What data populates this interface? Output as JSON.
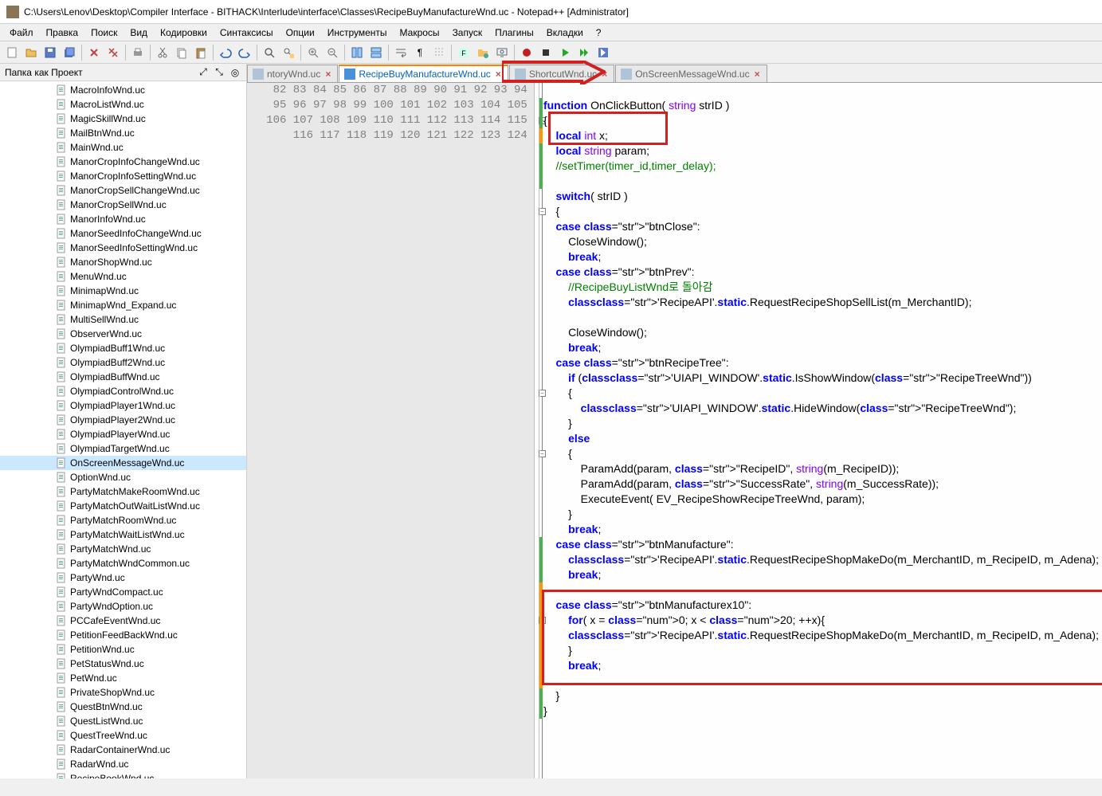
{
  "window": {
    "title": "C:\\Users\\Lenov\\Desktop\\Compiler  Interface - BITHACK\\Interlude\\interface\\Classes\\RecipeBuyManufactureWnd.uc - Notepad++ [Administrator]"
  },
  "menu": {
    "items": [
      "Файл",
      "Правка",
      "Поиск",
      "Вид",
      "Кодировки",
      "Синтаксисы",
      "Опции",
      "Инструменты",
      "Макросы",
      "Запуск",
      "Плагины",
      "Вкладки",
      "?"
    ]
  },
  "sidebar": {
    "title": "Папка как Проект",
    "files": [
      "MacroInfoWnd.uc",
      "MacroListWnd.uc",
      "MagicSkillWnd.uc",
      "MailBtnWnd.uc",
      "MainWnd.uc",
      "ManorCropInfoChangeWnd.uc",
      "ManorCropInfoSettingWnd.uc",
      "ManorCropSellChangeWnd.uc",
      "ManorCropSellWnd.uc",
      "ManorInfoWnd.uc",
      "ManorSeedInfoChangeWnd.uc",
      "ManorSeedInfoSettingWnd.uc",
      "ManorShopWnd.uc",
      "MenuWnd.uc",
      "MinimapWnd.uc",
      "MinimapWnd_Expand.uc",
      "MultiSellWnd.uc",
      "ObserverWnd.uc",
      "OlympiadBuff1Wnd.uc",
      "OlympiadBuff2Wnd.uc",
      "OlympiadBuffWnd.uc",
      "OlympiadControlWnd.uc",
      "OlympiadPlayer1Wnd.uc",
      "OlympiadPlayer2Wnd.uc",
      "OlympiadPlayerWnd.uc",
      "OlympiadTargetWnd.uc",
      "OnScreenMessageWnd.uc",
      "OptionWnd.uc",
      "PartyMatchMakeRoomWnd.uc",
      "PartyMatchOutWaitListWnd.uc",
      "PartyMatchRoomWnd.uc",
      "PartyMatchWaitListWnd.uc",
      "PartyMatchWnd.uc",
      "PartyMatchWndCommon.uc",
      "PartyWnd.uc",
      "PartyWndCompact.uc",
      "PartyWndOption.uc",
      "PCCafeEventWnd.uc",
      "PetitionFeedBackWnd.uc",
      "PetitionWnd.uc",
      "PetStatusWnd.uc",
      "PetWnd.uc",
      "PrivateShopWnd.uc",
      "QuestBtnWnd.uc",
      "QuestListWnd.uc",
      "QuestTreeWnd.uc",
      "RadarContainerWnd.uc",
      "RadarWnd.uc",
      "RecipeBookWnd.uc"
    ],
    "selected": "OnScreenMessageWnd.uc"
  },
  "tabs": {
    "items": [
      {
        "label": "ntoryWnd.uc",
        "active": false,
        "dim": true
      },
      {
        "label": "RecipeBuyManufactureWnd.uc",
        "active": true,
        "dim": false
      },
      {
        "label": "ShortcutWnd.uc",
        "active": false,
        "dim": true
      },
      {
        "label": "OnScreenMessageWnd.uc",
        "active": false,
        "dim": true
      }
    ]
  },
  "code": {
    "first_line": 82,
    "lines": [
      {
        "n": 82,
        "t": ""
      },
      {
        "n": 83,
        "t": "function OnClickButton( string strID )"
      },
      {
        "n": 84,
        "t": "{"
      },
      {
        "n": 85,
        "t": "    local int x;"
      },
      {
        "n": 86,
        "t": "    local string param;"
      },
      {
        "n": 87,
        "t": "    //setTimer(timer_id,timer_delay);"
      },
      {
        "n": 88,
        "t": ""
      },
      {
        "n": 89,
        "t": "    switch( strID )"
      },
      {
        "n": 90,
        "t": "    {"
      },
      {
        "n": 91,
        "t": "    case \"btnClose\":"
      },
      {
        "n": 92,
        "t": "        CloseWindow();"
      },
      {
        "n": 93,
        "t": "        break;"
      },
      {
        "n": 94,
        "t": "    case \"btnPrev\":"
      },
      {
        "n": 95,
        "t": "        //RecipeBuyListWnd로 돌아감"
      },
      {
        "n": 96,
        "t": "        class'RecipeAPI'.static.RequestRecipeShopSellList(m_MerchantID);"
      },
      {
        "n": 97,
        "t": ""
      },
      {
        "n": 98,
        "t": "        CloseWindow();"
      },
      {
        "n": 99,
        "t": "        break;"
      },
      {
        "n": 100,
        "t": "    case \"btnRecipeTree\":"
      },
      {
        "n": 101,
        "t": "        if (class'UIAPI_WINDOW'.static.IsShowWindow(\"RecipeTreeWnd\"))"
      },
      {
        "n": 102,
        "t": "        {"
      },
      {
        "n": 103,
        "t": "            class'UIAPI_WINDOW'.static.HideWindow(\"RecipeTreeWnd\");"
      },
      {
        "n": 104,
        "t": "        }"
      },
      {
        "n": 105,
        "t": "        else"
      },
      {
        "n": 106,
        "t": "        {"
      },
      {
        "n": 107,
        "t": "            ParamAdd(param, \"RecipeID\", string(m_RecipeID));"
      },
      {
        "n": 108,
        "t": "            ParamAdd(param, \"SuccessRate\", string(m_SuccessRate));"
      },
      {
        "n": 109,
        "t": "            ExecuteEvent( EV_RecipeShowRecipeTreeWnd, param);"
      },
      {
        "n": 110,
        "t": "        }"
      },
      {
        "n": 111,
        "t": "        break;"
      },
      {
        "n": 112,
        "t": "    case \"btnManufacture\":"
      },
      {
        "n": 113,
        "t": "        class'RecipeAPI'.static.RequestRecipeShopMakeDo(m_MerchantID, m_RecipeID, m_Adena);"
      },
      {
        "n": 114,
        "t": "        break;"
      },
      {
        "n": 115,
        "t": ""
      },
      {
        "n": 116,
        "t": "    case \"btnManufacturex10\":"
      },
      {
        "n": 117,
        "t": "        for( x = 0; x < 20; ++x){"
      },
      {
        "n": 118,
        "t": "        class'RecipeAPI'.static.RequestRecipeShopMakeDo(m_MerchantID, m_RecipeID, m_Adena);"
      },
      {
        "n": 119,
        "t": "        }"
      },
      {
        "n": 120,
        "t": "        break;"
      },
      {
        "n": 121,
        "t": ""
      },
      {
        "n": 122,
        "t": "    }"
      },
      {
        "n": 123,
        "t": "}"
      },
      {
        "n": 124,
        "t": ""
      }
    ]
  }
}
